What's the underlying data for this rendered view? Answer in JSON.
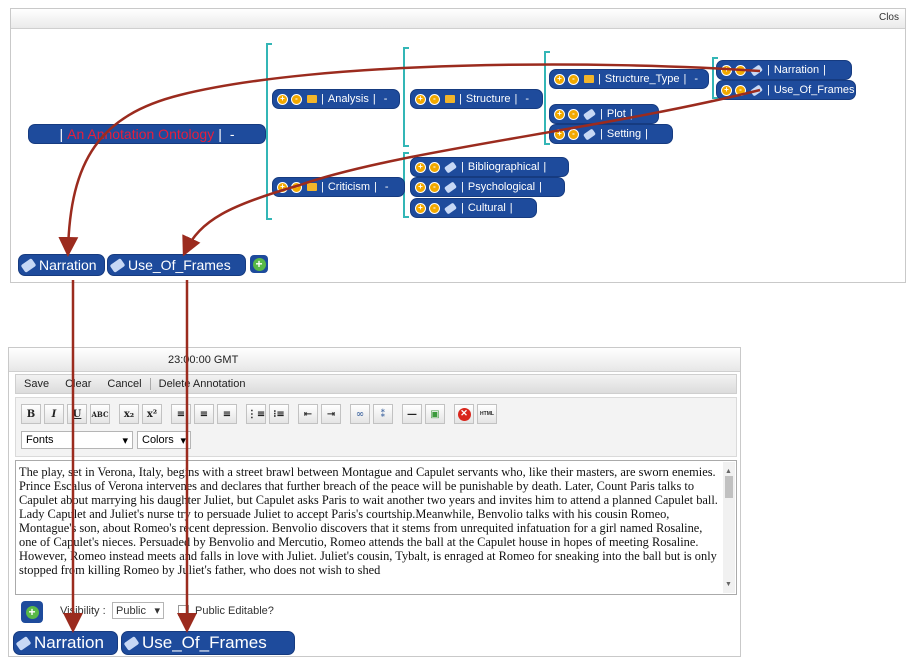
{
  "top_bar": {
    "close_label": "Clos"
  },
  "ontology": {
    "root": "An Annotation Ontology",
    "root_dash": "-",
    "nodes": {
      "analysis": "Analysis",
      "criticism": "Criticism",
      "structure": "Structure",
      "structure_type": "Structure_Type",
      "narration": "Narration",
      "use_of_frames": "Use_Of_Frames",
      "plot": "Plot",
      "setting": "Setting",
      "bibliographical": "Bibliographical",
      "psychological": "Psychological",
      "cultural": "Cultural"
    },
    "collapse_symbol": "-",
    "expand_symbol": "+"
  },
  "top_tags": [
    "Narration",
    "Use_Of_Frames"
  ],
  "editor": {
    "title": "23:00:00 GMT",
    "tabs": [
      "Save",
      "Clear",
      "Cancel",
      "Delete Annotation"
    ],
    "toolbar_buttons": [
      "B",
      "I",
      "U",
      "ABC",
      "x₂",
      "x²",
      "align-left-icon",
      "align-center-icon",
      "align-right-icon",
      "ordered-list-icon",
      "unordered-list-icon",
      "outdent-icon",
      "indent-icon",
      "link-icon",
      "unlink-icon",
      "horizontal-rule-icon",
      "image-icon",
      "remove-format-icon",
      "HTML"
    ],
    "fonts_value": "Fonts",
    "colors_value": "Colors",
    "body_text": "The play, set in Verona, Italy, begins with a street brawl between Montague and Capulet servants who, like their masters, are sworn enemies. Prince Escalus of Verona intervenes and declares that further breach of the peace will be punishable by death. Later, Count Paris talks to Capulet about marrying his daughter Juliet, but Capulet asks Paris to wait another two years and invites him to attend a planned Capulet ball. Lady Capulet and Juliet's nurse try to persuade Juliet to accept Paris's courtship.Meanwhile, Benvolio talks with his cousin Romeo, Montague's son, about Romeo's recent depression. Benvolio discovers that it stems from unrequited infatuation for a girl named Rosaline, one of Capulet's nieces. Persuaded by Benvolio and Mercutio, Romeo attends the ball at the Capulet house in hopes of meeting Rosaline. However, Romeo instead meets and falls in love with Juliet. Juliet's cousin, Tybalt, is enraged at Romeo for sneaking into the ball but is only stopped from killing Romeo by Juliet's father, who does not wish to shed",
    "visibility_label": "Visibility :",
    "visibility_value": "Public",
    "public_editable_label": "Public Editable?"
  },
  "bottom_tags": [
    "Narration",
    "Use_Of_Frames"
  ],
  "colors": {
    "node_blue": "#1e4b9c",
    "bracket_teal": "#33b6b6",
    "arrow_red": "#9b2b1e",
    "root_text": "#e61e3c",
    "add_green": "#58b947"
  }
}
